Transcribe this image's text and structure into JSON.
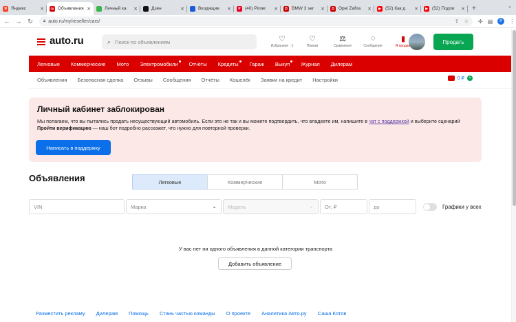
{
  "browser": {
    "tabs": [
      {
        "label": "Яндекс",
        "fav_color": "#fc3f1d",
        "fav_char": "Я",
        "active": false
      },
      {
        "label": "Объявления",
        "fav_color": "#db0000",
        "fav_char": "ru",
        "active": true
      },
      {
        "label": "Личный ка",
        "fav_color": "#3cb34f",
        "fav_char": "",
        "active": false
      },
      {
        "label": "Дзен",
        "fav_color": "#111111",
        "fav_char": "",
        "active": false
      },
      {
        "label": "Входящие",
        "fav_color": "#1a5bd6",
        "fav_char": "",
        "active": false
      },
      {
        "label": "(40) Pinter",
        "fav_color": "#e60023",
        "fav_char": "P",
        "active": false
      },
      {
        "label": "BMW 3 ser",
        "fav_color": "#cc0000",
        "fav_char": "D",
        "active": false
      },
      {
        "label": "Opel Zafira",
        "fav_color": "#cc0000",
        "fav_char": "D",
        "active": false
      },
      {
        "label": "(52) Как д",
        "fav_color": "#ff0000",
        "fav_char": "▶",
        "active": false
      },
      {
        "label": "(52) Подпи",
        "fav_color": "#ff0000",
        "fav_char": "▶",
        "active": false
      }
    ],
    "new_tab": "+",
    "url": "auto.ru/my/reseller/cars/",
    "profile_letter": "P"
  },
  "header": {
    "logo": "auto.ru",
    "search_placeholder": "Поиск по объявлениям",
    "icons": [
      {
        "name": "favorites-icon",
        "glyph": "♡",
        "label": "Избранное · 1",
        "red": false
      },
      {
        "name": "searches-icon",
        "glyph": "♡",
        "label": "Поиски",
        "red": false
      },
      {
        "name": "compare-icon",
        "glyph": "⚖",
        "label": "Сравнения",
        "red": false
      },
      {
        "name": "messages-icon",
        "glyph": "◌",
        "label": "Сообщения",
        "red": false
      },
      {
        "name": "sell-page-icon",
        "glyph": "▮",
        "label": "Я продаю",
        "red": true
      }
    ],
    "sell_button": "Продать"
  },
  "red_nav": [
    {
      "label": "Легковые",
      "dot": false
    },
    {
      "label": "Коммерческие",
      "dot": false
    },
    {
      "label": "Мото",
      "dot": false
    },
    {
      "label": "Электромобили",
      "dot": true
    },
    {
      "label": "Отчёты",
      "dot": false
    },
    {
      "label": "Кредиты",
      "dot": true
    },
    {
      "label": "Гараж",
      "dot": false
    },
    {
      "label": "Выкуп",
      "dot": true
    },
    {
      "label": "Журнал",
      "dot": false
    },
    {
      "label": "Дилерам",
      "dot": false
    }
  ],
  "sub_nav": [
    "Объявления",
    "Безопасная сделка",
    "Отзывы",
    "Сообщения",
    "Отчёты",
    "Кошелёк",
    "Заявки на кредит",
    "Настройки"
  ],
  "wallet": {
    "balance": "0 ₽",
    "plus": "+"
  },
  "banner": {
    "title": "Личный кабинет заблокирован",
    "text_before_link": "Мы полагаем, что вы пытались продать несуществующий автомобиль. Если это не так и вы можете подтвердить, что владеете им, напишите в ",
    "link": "чат с поддержкой",
    "text_after_link": " и выберите сценарий ",
    "bold": "Пройти верификацию",
    "text_end": " — наш бот подробно расскажет, что нужно для повторной проверки.",
    "button": "Написать в поддержку"
  },
  "ads": {
    "title": "Объявления",
    "segments": [
      "Легковые",
      "Коммерческие",
      "Мото"
    ],
    "active_segment": 0,
    "filters": {
      "vin": "VIN",
      "make": "Марка",
      "model": "Модель",
      "price_from": "От, ₽",
      "price_to": "до"
    },
    "toggle_label": "Графики у всех",
    "empty_text": "У вас нет ни одного объявления в данной категории транспорта",
    "add_button": "Добавить объявление"
  },
  "footer": [
    "Разместить рекламу",
    "Дилерам",
    "Помощь",
    "Стань частью команды",
    "О проекте",
    "Аналитика Авто.ру",
    "Саша Котов"
  ]
}
